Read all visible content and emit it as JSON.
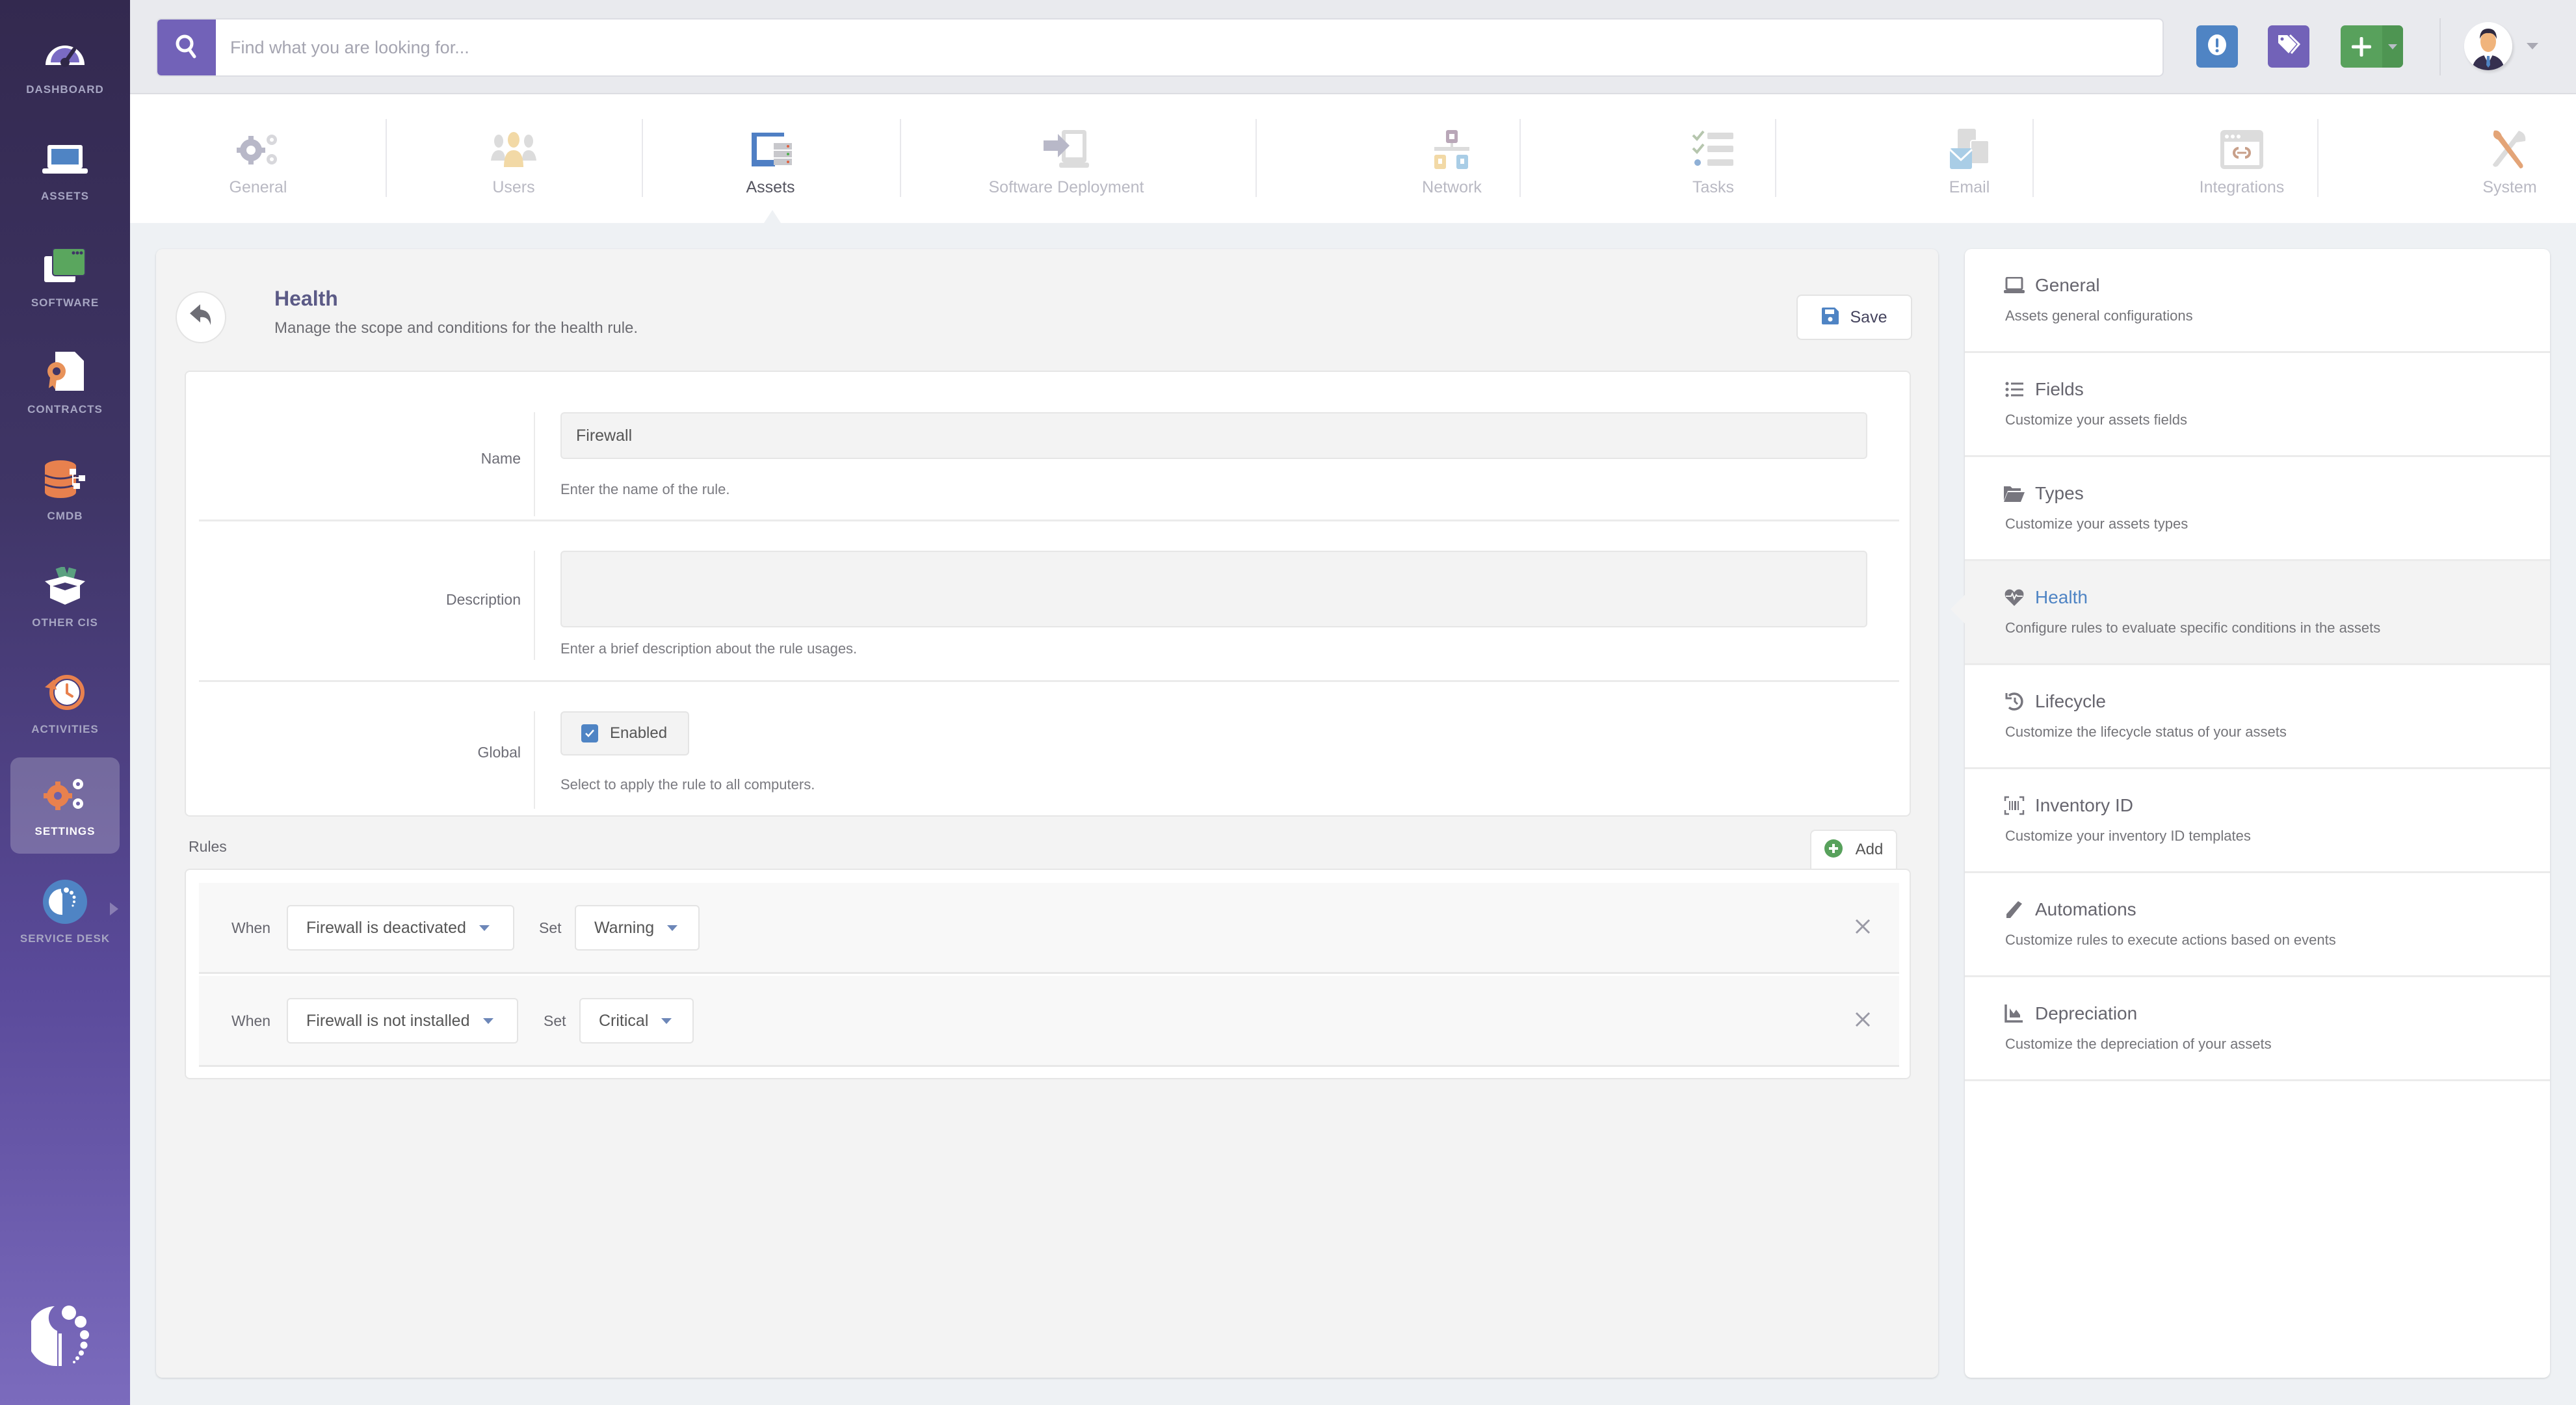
{
  "sidebar": {
    "items": [
      {
        "label": "DASHBOARD",
        "icon": "dashboard-gauge-icon"
      },
      {
        "label": "ASSETS",
        "icon": "laptop-icon"
      },
      {
        "label": "SOFTWARE",
        "icon": "software-window-icon"
      },
      {
        "label": "CONTRACTS",
        "icon": "contract-document-icon"
      },
      {
        "label": "CMDB",
        "icon": "database-icon"
      },
      {
        "label": "OTHER CIS",
        "icon": "open-box-icon"
      },
      {
        "label": "ACTIVITIES",
        "icon": "history-clock-icon"
      },
      {
        "label": "SETTINGS",
        "icon": "gears-icon",
        "active": true
      },
      {
        "label": "SERVICE DESK",
        "icon": "service-desk-icon"
      }
    ]
  },
  "search": {
    "placeholder": "Find what you are looking for..."
  },
  "toolbar": {
    "alert_icon": "exclamation-circle-icon",
    "tags_icon": "tags-icon",
    "add_icon": "plus-icon",
    "colors": {
      "alert": "#4f84c4",
      "tags": "#7262b8",
      "add": "#58a15c"
    }
  },
  "tabs": [
    {
      "label": "General"
    },
    {
      "label": "Users"
    },
    {
      "label": "Assets",
      "active": true
    },
    {
      "label": "Software Deployment"
    },
    {
      "label": "Network"
    },
    {
      "label": "Tasks"
    },
    {
      "label": "Email"
    },
    {
      "label": "Integrations"
    },
    {
      "label": "System"
    }
  ],
  "page": {
    "title": "Health",
    "subtitle": "Manage the scope and conditions for the health rule.",
    "save_label": "Save"
  },
  "form": {
    "name": {
      "label": "Name",
      "value": "Firewall",
      "help": "Enter the name of the rule."
    },
    "description": {
      "label": "Description",
      "value": "",
      "help": "Enter a brief description about the rule usages."
    },
    "global": {
      "label": "Global",
      "checkbox_label": "Enabled",
      "checked": true,
      "help": "Select to apply the rule to all computers."
    }
  },
  "rules": {
    "label": "Rules",
    "add_label": "Add",
    "when_label": "When",
    "set_label": "Set",
    "items": [
      {
        "condition": "Firewall is deactivated",
        "status": "Warning"
      },
      {
        "condition": "Firewall is not installed",
        "status": "Critical"
      }
    ]
  },
  "right_panel": {
    "items": [
      {
        "title": "General",
        "desc": "Assets general configurations",
        "icon": "laptop-icon"
      },
      {
        "title": "Fields",
        "desc": "Customize your assets fields",
        "icon": "list-icon"
      },
      {
        "title": "Types",
        "desc": "Customize your assets types",
        "icon": "folder-open-icon"
      },
      {
        "title": "Health",
        "desc": "Configure rules to evaluate specific conditions in the assets",
        "icon": "heartbeat-icon",
        "active": true
      },
      {
        "title": "Lifecycle",
        "desc": "Customize the lifecycle status of your assets",
        "icon": "history-icon"
      },
      {
        "title": "Inventory ID",
        "desc": "Customize your inventory ID templates",
        "icon": "barcode-icon"
      },
      {
        "title": "Automations",
        "desc": "Customize rules to execute actions based on events",
        "icon": "pencil-icon"
      },
      {
        "title": "Depreciation",
        "desc": "Customize the depreciation of your assets",
        "icon": "chart-area-icon"
      }
    ]
  }
}
